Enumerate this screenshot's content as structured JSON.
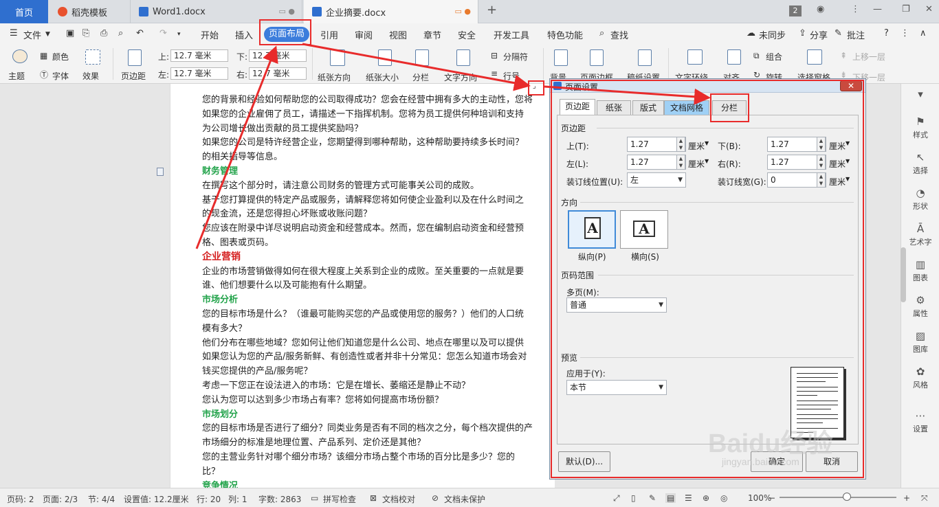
{
  "titlebar": {
    "home_tab": "首页",
    "tabs": [
      {
        "label": "稻壳模板"
      },
      {
        "label": "Word1.docx"
      },
      {
        "label": "企业摘要.docx"
      }
    ],
    "new_tab": "+",
    "window_count": "2"
  },
  "menubar": {
    "file_label": "文件",
    "items": [
      "开始",
      "插入",
      "页面布局",
      "引用",
      "审阅",
      "视图",
      "章节",
      "安全",
      "开发工具",
      "特色功能"
    ],
    "search_label": "查找",
    "sync_label": "未同步",
    "share_label": "分享",
    "comment_label": "批注"
  },
  "ribbon": {
    "theme": "主题",
    "color": "颜色",
    "font": "字体",
    "effect": "效果",
    "margins": "页边距",
    "top_label": "上:",
    "top_value": "12.7 毫米",
    "bottom_label": "下:",
    "bottom_value": "12.7 毫米",
    "left_label": "左:",
    "left_value": "12.7 毫米",
    "right_label": "右:",
    "right_value": "12.7 毫米",
    "orientation": "纸张方向",
    "size": "纸张大小",
    "columns": "分栏",
    "text_direction": "文字方向",
    "breaks": "分隔符",
    "line_numbers": "行号",
    "background": "背景",
    "page_border": "页面边框",
    "draft_paper": "稿纸设置",
    "wrap": "文字环绕",
    "align": "对齐",
    "group": "组合",
    "rotate": "旋转",
    "select_pane": "选择窗格",
    "bring_forward": "上移一层",
    "send_backward": "下移一层"
  },
  "document": {
    "lines": [
      {
        "text": "您的背景和经验如何帮助您的公司取得成功？您会在经营中拥有多大的主动性，您将",
        "style": "body"
      },
      {
        "text": "如果您的企业雇佣了员工，请描述一下指挥机制。您将为员工提供何种培训和支持",
        "style": "body"
      },
      {
        "text": "为公司增长做出贡献的员工提供奖励吗？",
        "style": "body"
      },
      {
        "text": "如果您的公司是特许经营企业，您期望得到哪种帮助，这种帮助要持续多长时间？",
        "style": "body"
      },
      {
        "text": "的相关指导等信息。",
        "style": "body"
      },
      {
        "text": "财务管理",
        "style": "green"
      },
      {
        "text": "在撰写这个部分时，请注意公司财务的管理方式可能事关公司的成败。",
        "style": "body"
      },
      {
        "text": "基于您打算提供的特定产品或服务，请解释您将如何使企业盈利以及在什么时间之",
        "style": "body"
      },
      {
        "text": "的现金流，还是您得担心坏账或收账问题？",
        "style": "body"
      },
      {
        "text": "您应该在附录中详尽说明启动资金和经营成本。然而，您在编制启动资金和经营预",
        "style": "body"
      },
      {
        "text": "格、图表或页码。",
        "style": "body"
      },
      {
        "text": "企业营销",
        "style": "red"
      },
      {
        "text": "企业的市场营销做得如何在很大程度上关系到企业的成败。至关重要的一点就是要",
        "style": "body"
      },
      {
        "text": "谁、他们想要什么以及可能抱有什么期望。",
        "style": "body"
      },
      {
        "text": "市场分析",
        "style": "green"
      },
      {
        "text": "您的目标市场是什么？（谁最可能购买您的产品或使用您的服务？）他们的人口统",
        "style": "body"
      },
      {
        "text": "模有多大？",
        "style": "body"
      },
      {
        "text": "他们分布在哪些地域？您如何让他们知道您是什么公司、地点在哪里以及可以提供",
        "style": "body"
      },
      {
        "text": "如果您认为您的产品/服务新鲜、有创造性或者并非十分常见：您怎么知道市场会对",
        "style": "body"
      },
      {
        "text": "钱买您提供的产品/服务呢？",
        "style": "body"
      },
      {
        "text": "考虑一下您正在设法进入的市场：它是在增长、萎缩还是静止不动？",
        "style": "body"
      },
      {
        "text": "您认为您可以达到多少市场占有率？您将如何提高市场份额？",
        "style": "body"
      },
      {
        "text": "市场划分",
        "style": "green"
      },
      {
        "text": "您的目标市场是否进行了细分？同类业务是否有不同的档次之分，每个档次提供的产",
        "style": "body"
      },
      {
        "text": "市场细分的标准是地理位置、产品系列、定价还是其他？",
        "style": "body"
      },
      {
        "text": "您的主营业务针对哪个细分市场？该细分市场占整个市场的百分比是多少？您的",
        "style": "body"
      },
      {
        "text": "比？",
        "style": "body"
      },
      {
        "text": "竞争情况",
        "style": "green"
      }
    ]
  },
  "sidebar": {
    "items": [
      "样式",
      "选择",
      "形状",
      "艺术字",
      "图表",
      "属性",
      "图库",
      "风格",
      "设置"
    ]
  },
  "statusbar": {
    "page_no": "页码: 2",
    "page": "页面: 2/3",
    "section": "节: 4/4",
    "setting": "设置值: 12.2厘米",
    "row": "行: 20",
    "col": "列: 1",
    "words": "字数: 2863",
    "spell": "拼写检查",
    "proof": "文档校对",
    "protect": "文档未保护",
    "zoom": "100%"
  },
  "dialog": {
    "title": "页面设置",
    "tabs": [
      "页边距",
      "纸张",
      "版式",
      "文档网格",
      "分栏"
    ],
    "margins_group": "页边距",
    "top_label": "上(T):",
    "top_value": "1.27",
    "bottom_label": "下(B):",
    "bottom_value": "1.27",
    "left_label": "左(L):",
    "left_value": "1.27",
    "right_label": "右(R):",
    "right_value": "1.27",
    "unit": "厘米",
    "gutter_pos_label": "装订线位置(U):",
    "gutter_pos_value": "左",
    "gutter_width_label": "装订线宽(G):",
    "gutter_width_value": "0",
    "orientation_group": "方向",
    "portrait": "纵向(P)",
    "landscape": "横向(S)",
    "glyph": "A",
    "pages_group": "页码范围",
    "multi_label": "多页(M):",
    "multi_value": "普通",
    "preview_group": "预览",
    "apply_label": "应用于(Y):",
    "apply_value": "本节",
    "default_button": "默认(D)...",
    "ok_button": "确定",
    "cancel_button": "取消"
  },
  "watermark": {
    "text": "Baidu经验",
    "url": "jingyan.baidu.com"
  },
  "colors": {
    "accent": "#3c7ddc",
    "annotation": "#e82b2b",
    "heading_green": "#22a34a",
    "heading_red": "#d51f1f"
  }
}
